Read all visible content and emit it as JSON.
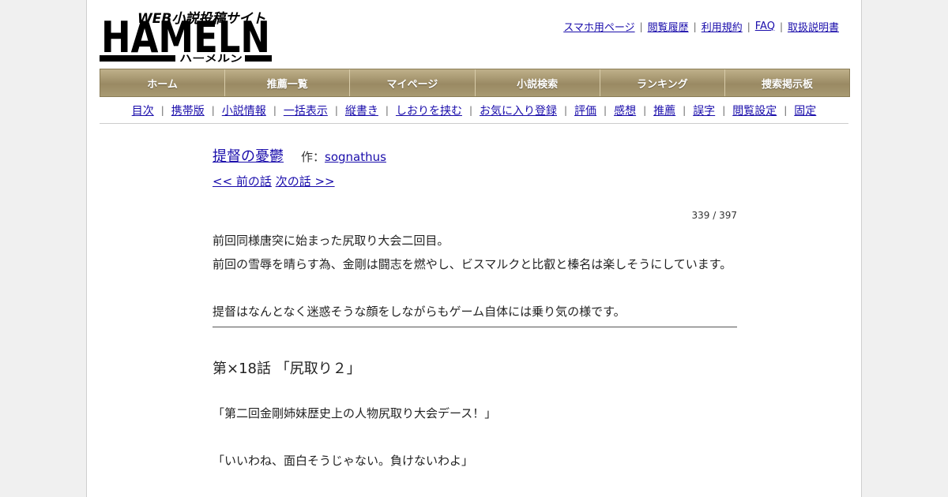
{
  "logo": {
    "tagline": "WEB小説投稿サイト",
    "name": "HAMELN",
    "kana": "ハーメルン"
  },
  "top_links": [
    "スマホ用ページ",
    "閲覧履歴",
    "利用規約",
    "FAQ",
    "取扱説明書"
  ],
  "main_nav": [
    "ホーム",
    "推薦一覧",
    "マイページ",
    "小説検索",
    "ランキング",
    "捜索掲示板"
  ],
  "sub_nav": [
    "目次",
    "携帯版",
    "小説情報",
    "一括表示",
    "縦書き",
    "しおりを挟む",
    "お気に入り登録",
    "評価",
    "感想",
    "推薦",
    "誤字",
    "閲覧設定",
    "固定"
  ],
  "novel": {
    "title": "提督の憂鬱",
    "author_label": "作：",
    "author": "sognathus",
    "prev": "<< 前の話",
    "next": "次の話 >>",
    "count": "339 / 397"
  },
  "preface": [
    "前回同様唐突に始まった尻取り大会二回目。",
    "前回の雪辱を晴らす為、金剛は闘志を燃やし、ビスマルクと比叡と榛名は楽しそうにしています。",
    "",
    "提督はなんとなく迷惑そうな顔をしながらもゲーム自体には乗り気の様です。"
  ],
  "chapter_title": "第×18話 「尻取り２」",
  "body": [
    "「第二回金剛姉妹歴史上の人物尻取り大会デース！」",
    "「いいわね、面白そうじゃない。負けないわよ」"
  ]
}
